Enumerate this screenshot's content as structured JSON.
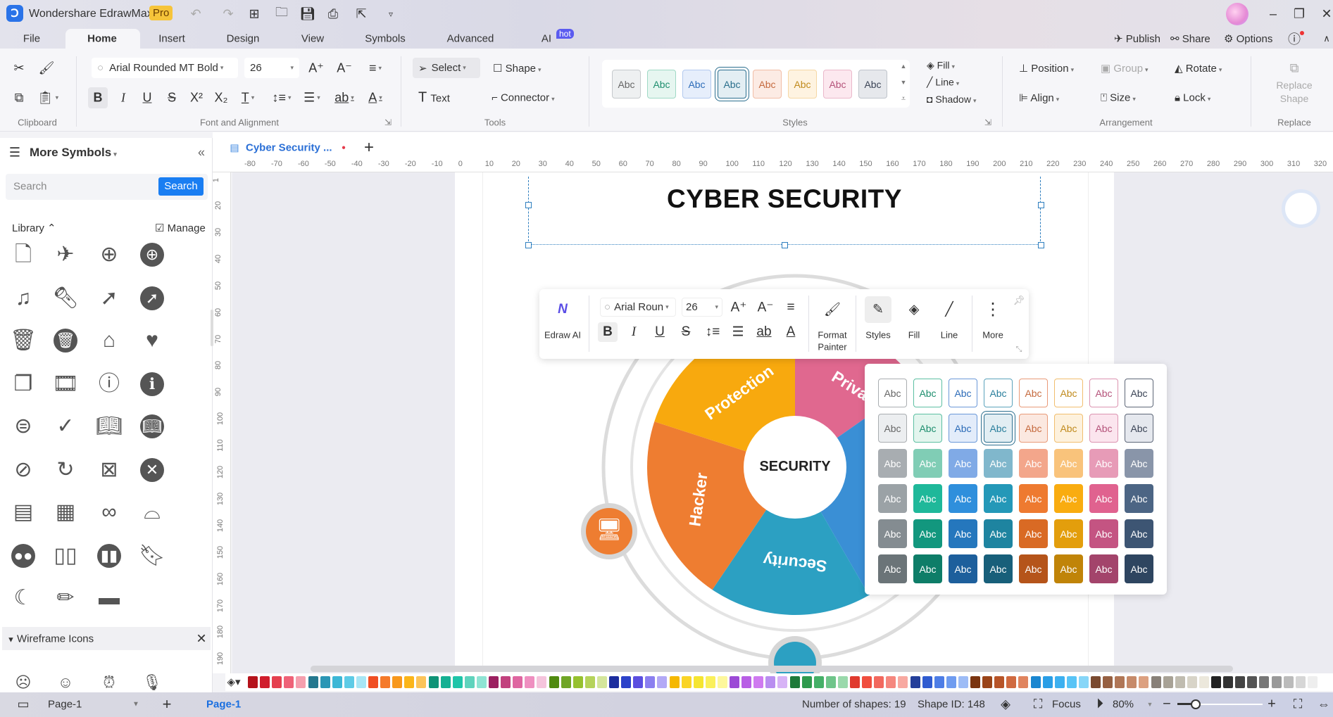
{
  "app": {
    "title": "Wondershare EdrawMax",
    "badge": "Pro"
  },
  "window": {
    "minimize": "–",
    "restore": "❐",
    "close": "✕"
  },
  "menu_tabs": [
    {
      "label": "File"
    },
    {
      "label": "Home",
      "active": true
    },
    {
      "label": "Insert"
    },
    {
      "label": "Design"
    },
    {
      "label": "View"
    },
    {
      "label": "Symbols"
    },
    {
      "label": "Advanced"
    },
    {
      "label": "AI",
      "badge": "hot"
    }
  ],
  "top_actions": {
    "publish": "Publish",
    "share": "Share",
    "options": "Options"
  },
  "ribbon": {
    "clipboard_label": "Clipboard",
    "font": {
      "family": "Arial Rounded MT Bold",
      "size": "26",
      "group_label": "Font and Alignment"
    },
    "tools": {
      "select": "Select",
      "shape": "Shape",
      "text": "Text",
      "connector": "Connector",
      "group_label": "Tools"
    },
    "styles": {
      "group_label": "Styles",
      "sample": "Abc"
    },
    "fill": "Fill",
    "line": "Line",
    "shadow": "Shadow",
    "arrangement": {
      "position": "Position",
      "group": "Group",
      "rotate": "Rotate",
      "align": "Align",
      "size": "Size",
      "lock": "Lock",
      "group_label": "Arrangement"
    },
    "replace": {
      "line1": "Replace",
      "line2": "Shape",
      "group_label": "Replace"
    }
  },
  "document_tab": {
    "title": "Cyber Security ...",
    "unsaved_dot": "●",
    "add": "+"
  },
  "left_panel": {
    "title": "More Symbols",
    "search_placeholder": "Search",
    "search_button": "Search",
    "library_label": "Library",
    "manage_label": "Manage",
    "symbols": [
      "document",
      "paper-plane",
      "plus-circle",
      "plus-circle-filled",
      "music-list",
      "flashlight",
      "navigation-circle",
      "navigation-circle-filled",
      "trash",
      "trash-filled",
      "inbox",
      "heart-chat",
      "copy",
      "film",
      "info-circle",
      "info-circle-filled",
      "filter-circle",
      "check",
      "book-open",
      "book-open-filled",
      "compass",
      "replay",
      "archive-x",
      "close-circle-filled",
      "inbox-tray",
      "grid",
      "glasses",
      "voicemail",
      "voicemail-filled",
      "book",
      "book-filled",
      "bookmark",
      "moon",
      "pencil",
      "battery"
    ],
    "wireframe_label": "Wireframe Icons",
    "wireframe_symbols": [
      "sad-face",
      "smile-face",
      "alarm-clock",
      "microphone"
    ]
  },
  "ruler": {
    "h": [
      "-80",
      "-70",
      "-60",
      "-50",
      "-40",
      "-30",
      "-20",
      "-10",
      "0",
      "10",
      "20",
      "30",
      "40",
      "50",
      "60",
      "70",
      "80",
      "90",
      "100",
      "110",
      "120",
      "130",
      "140",
      "150",
      "160",
      "170",
      "180",
      "190",
      "200",
      "210",
      "220",
      "230",
      "240",
      "250",
      "260",
      "270",
      "280",
      "290",
      "300",
      "310",
      "320"
    ],
    "v": [
      "1",
      "20",
      "30",
      "40",
      "50",
      "60",
      "70",
      "80",
      "90",
      "100",
      "110",
      "120",
      "130",
      "140",
      "150",
      "160",
      "170",
      "180",
      "190"
    ]
  },
  "diagram": {
    "title": "CYBER SECURITY",
    "center": "SECURITY",
    "segments": [
      {
        "label": "Privacy",
        "color": "#E0688F"
      },
      {
        "label": "",
        "color": "#3A8FD5"
      },
      {
        "label": "Security",
        "color": "#2CA0C2"
      },
      {
        "label": "Hacker",
        "color": "#EE7D31"
      },
      {
        "label": "Protection",
        "color": "#F8A90E"
      }
    ],
    "icon_color": "#EE7D31"
  },
  "floating_toolbar": {
    "edraw_ai": "Edraw AI",
    "font": "Arial Roun",
    "size": "26",
    "format_painter_1": "Format",
    "format_painter_2": "Painter",
    "styles": "Styles",
    "fill": "Fill",
    "line": "Line",
    "more": "More"
  },
  "style_panel": {
    "sample": "Abc",
    "selected": [
      1,
      3
    ],
    "rows": [
      {
        "fills": [
          "#ffffff",
          "#ffffff",
          "#ffffff",
          "#ffffff",
          "#ffffff",
          "#ffffff",
          "#ffffff",
          "#ffffff"
        ],
        "borders": [
          "#a9adb0",
          "#5cbfa2",
          "#6a98d8",
          "#5aa2bb",
          "#e99a78",
          "#f1be6e",
          "#dc93b0",
          "#5d6677"
        ],
        "text": [
          "#666",
          "#1e8e6e",
          "#2d6cb8",
          "#2a7f9c",
          "#c56a3e",
          "#c08a1c",
          "#b5537a",
          "#3b4456"
        ]
      },
      {
        "fills": [
          "#eceef0",
          "#e3f5ee",
          "#e3ecfa",
          "#e2eef3",
          "#fbe8e0",
          "#fdf1dd",
          "#fbe5ee",
          "#e5e8ee"
        ],
        "borders": [
          "#a9adb0",
          "#5cbfa2",
          "#6a98d8",
          "#2c6f8f",
          "#e99a78",
          "#f1be6e",
          "#dc93b0",
          "#5d6677"
        ],
        "text": [
          "#666",
          "#1e8e6e",
          "#2d6cb8",
          "#2a7f9c",
          "#c56a3e",
          "#c08a1c",
          "#b5537a",
          "#3b4456"
        ]
      },
      {
        "fills": [
          "#a8adb1",
          "#80cdb5",
          "#80aae6",
          "#80b7cc",
          "#f3a68b",
          "#f9c37b",
          "#e79bb7",
          "#8995a9"
        ],
        "text": "#ffffff"
      },
      {
        "fills": [
          "#9ba2a6",
          "#1fb89a",
          "#2f8fdc",
          "#2498b8",
          "#ee7a30",
          "#f9ac10",
          "#e0628f",
          "#4c6584"
        ],
        "text": "#ffffff"
      },
      {
        "fills": [
          "#848c91",
          "#12977e",
          "#2577bd",
          "#1e84a0",
          "#d96a24",
          "#e39e0c",
          "#c45482",
          "#3d5573"
        ],
        "text": "#ffffff"
      },
      {
        "fills": [
          "#6b7478",
          "#0e7d68",
          "#1d5f9c",
          "#185f7a",
          "#b5541a",
          "#c08408",
          "#a3446b",
          "#2e4560"
        ],
        "text": "#ffffff"
      }
    ]
  },
  "ribbon_gallery": {
    "fills": [
      "#eef0f1",
      "#e6f6f0",
      "#e6eefb",
      "#e3eef3",
      "#fcebe4",
      "#fef3e1",
      "#fce8ef",
      "#e6e8ec"
    ],
    "borders": [
      "#c5c9cc",
      "#9fd9c5",
      "#b2c9ee",
      "#2c6f8f",
      "#f1bda6",
      "#f5d7a4",
      "#eab8ca",
      "#bfc4cb"
    ],
    "text": [
      "#666",
      "#1e8e6e",
      "#2d6cb8",
      "#2a6f8c",
      "#c56a3e",
      "#c08a1c",
      "#b5537a",
      "#3b4456"
    ],
    "selected": 3
  },
  "palette": [
    "#b5121b",
    "#d01d2c",
    "#e5404f",
    "#ef6278",
    "#f59fae",
    "#24788f",
    "#2b96b5",
    "#3cb7d6",
    "#5dcbe6",
    "#a7e6f5",
    "#f04e23",
    "#f57a2a",
    "#f8981d",
    "#fbb51a",
    "#fcc45a",
    "#0f9377",
    "#14b093",
    "#1fc5a9",
    "#5fd3bd",
    "#8fe4d4",
    "#9b2060",
    "#c2417e",
    "#df66a1",
    "#ef8fc0",
    "#f5c4dc",
    "#4f8a10",
    "#6fa526",
    "#96c12f",
    "#b5d35a",
    "#d4e69b",
    "#1c2d9e",
    "#2c42c9",
    "#5b4fe0",
    "#8b7ff0",
    "#b3a9f6",
    "#f5b800",
    "#fad426",
    "#f5e530",
    "#faf05a",
    "#fdf79c",
    "#9c4ad6",
    "#b85ee5",
    "#cf7af0",
    "#b98ef0",
    "#d7b3f6",
    "#1e7a3a",
    "#2f9a4e",
    "#45b068",
    "#6fc58a",
    "#9ad9ab",
    "#e03a2e",
    "#f04e3e",
    "#f2685e",
    "#f5877e",
    "#f8a9a1",
    "#243f9a",
    "#2f5bd0",
    "#4d7de6",
    "#6f9cf0",
    "#9dbcf6",
    "#7a3410",
    "#9a4418",
    "#b75428",
    "#d06a40",
    "#e0845e",
    "#1a86d0",
    "#2a9ee6",
    "#3cb0f0",
    "#58c4f6",
    "#86d6f8",
    "#7a4a30",
    "#966042",
    "#b07656",
    "#c68a6a",
    "#dca080",
    "#888078",
    "#a8a296",
    "#c0bcb0",
    "#d8d4c8",
    "#ece8dc",
    "#222222",
    "#333333",
    "#444444",
    "#555555",
    "#777777",
    "#999999",
    "#bbbbbb",
    "#d6d6d6",
    "#eeeeee"
  ],
  "status": {
    "page_selector": "Page-1",
    "add_page": "+",
    "current_page": "Page-1",
    "shapes": "Number of shapes: 19",
    "shape_id": "Shape ID: 148",
    "focus": "Focus",
    "zoom": "80%",
    "zoom_level": 80
  }
}
